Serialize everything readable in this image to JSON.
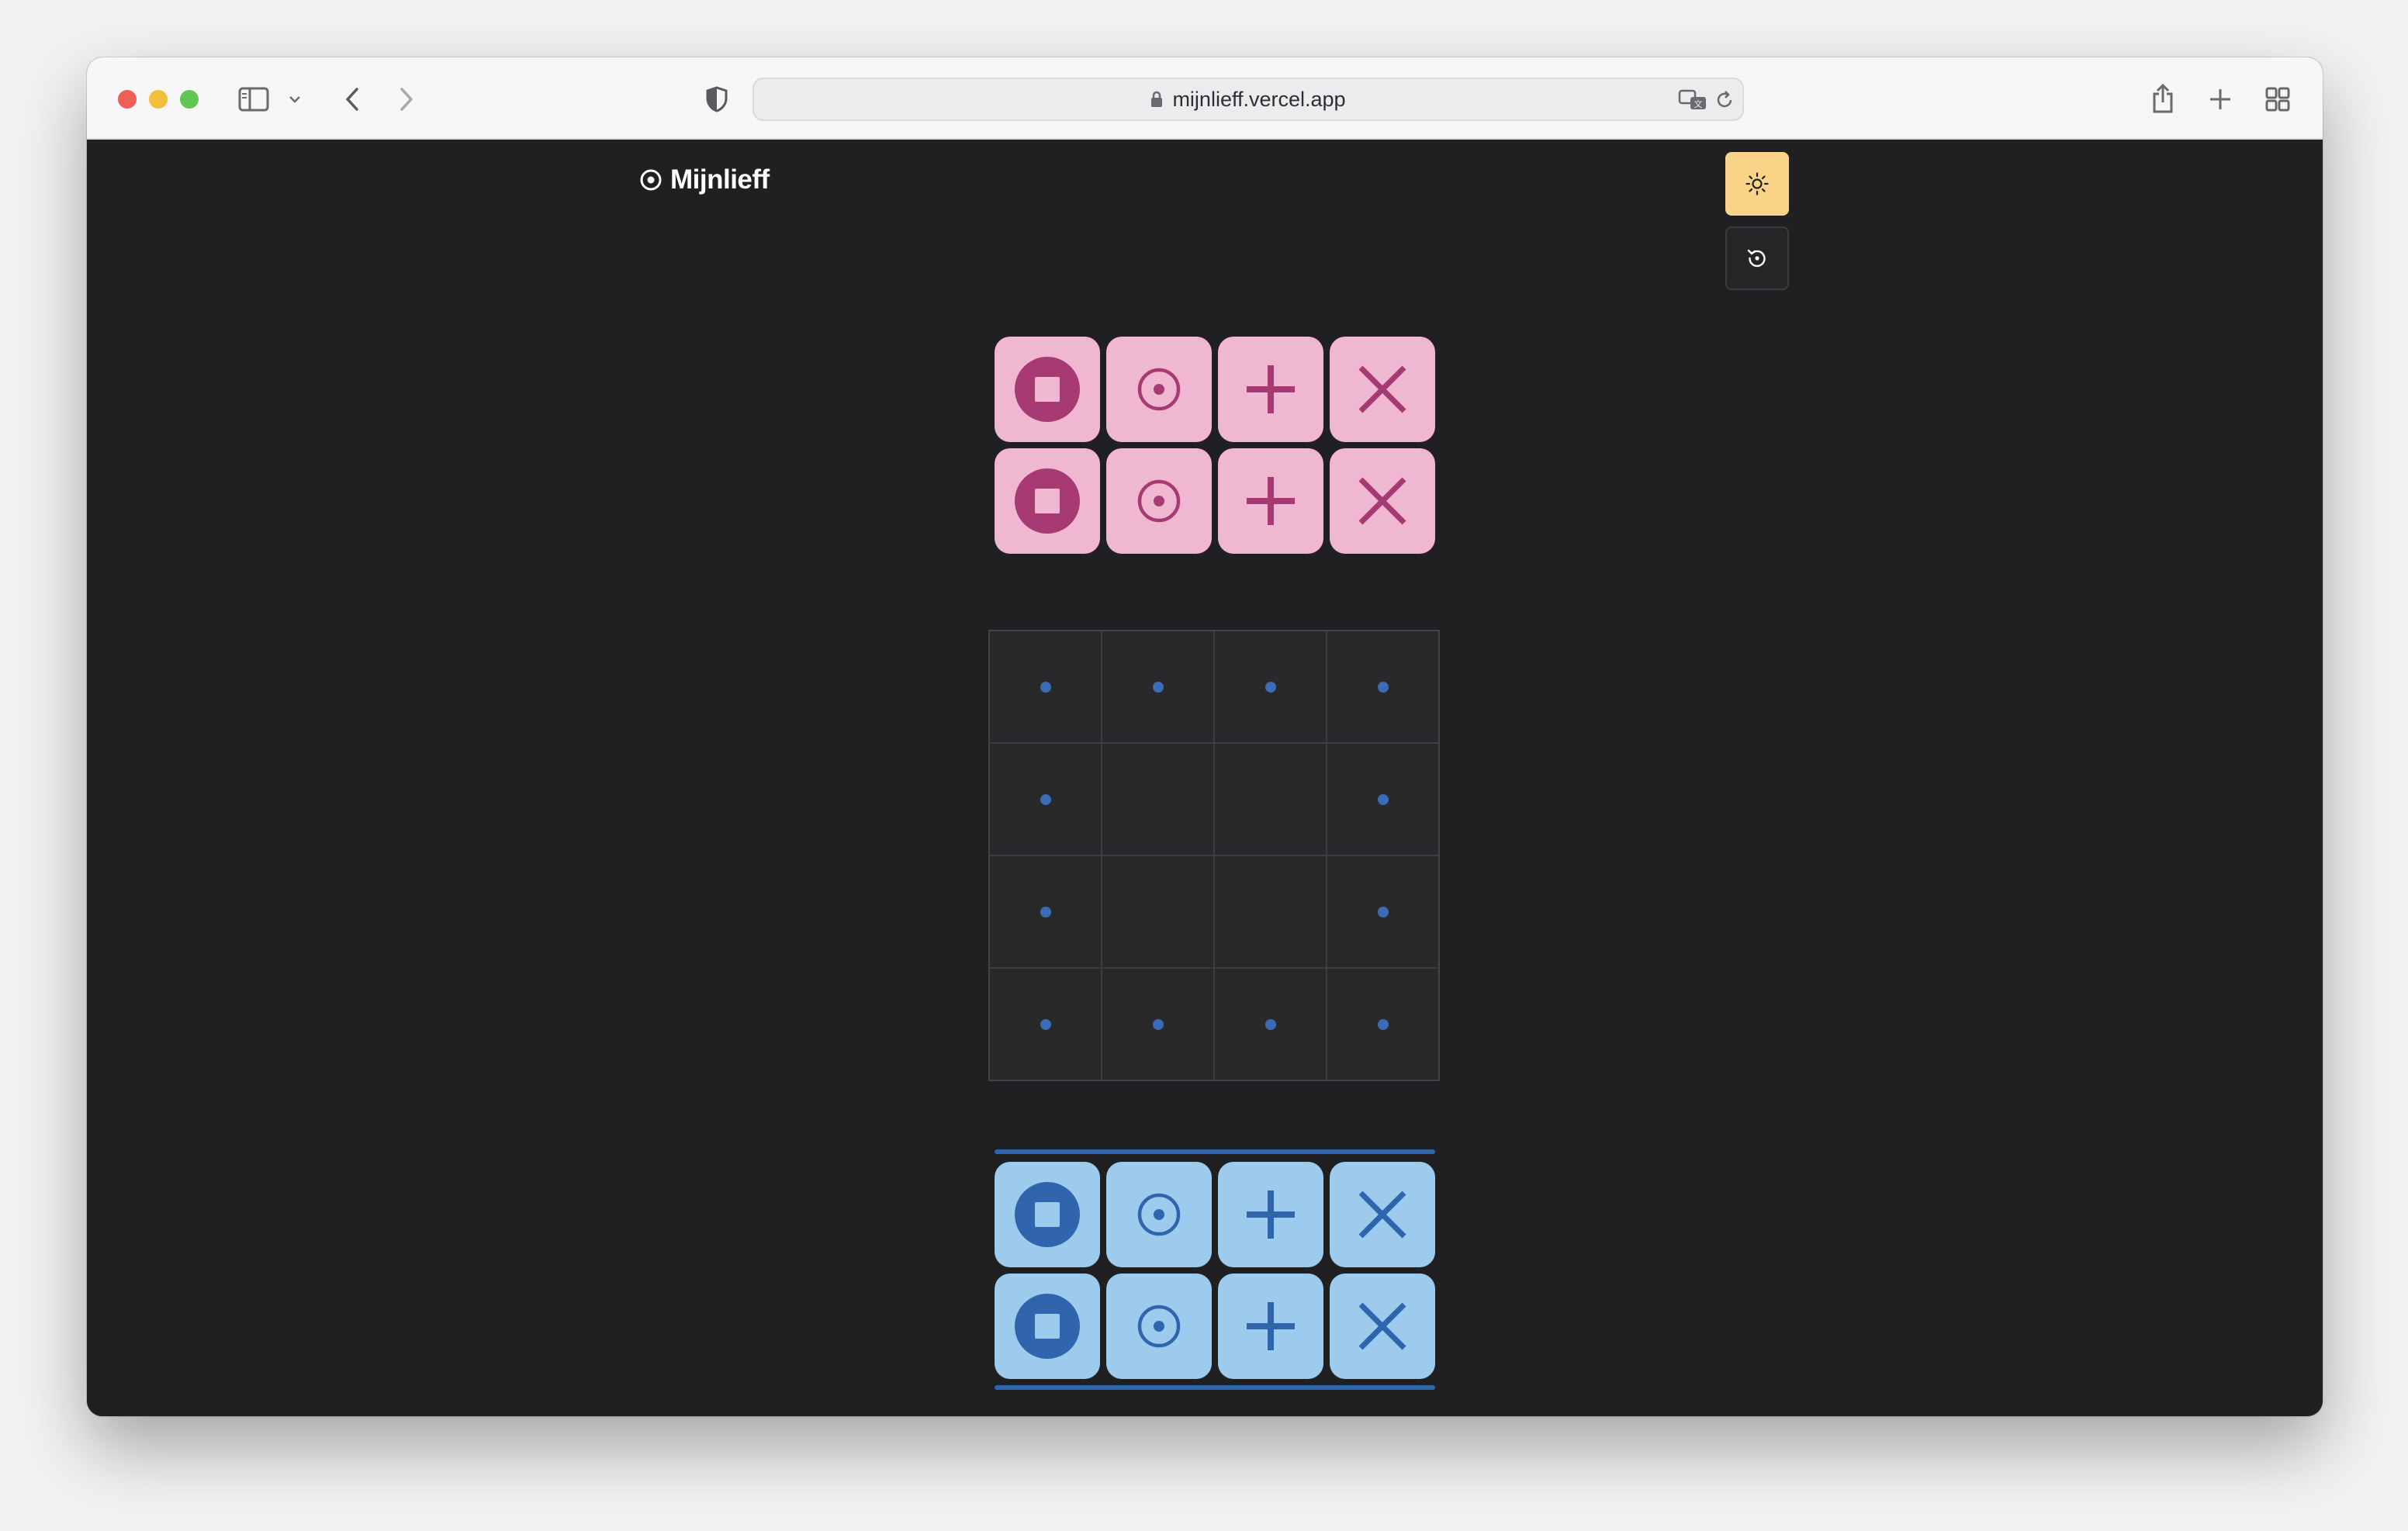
{
  "browser": {
    "url": "mijnlieff.vercel.app"
  },
  "app": {
    "logo_text": "Mijnlieff",
    "theme_toggle_icon": "sun-icon",
    "reset_icon": "rotate-icon"
  },
  "players": {
    "top": {
      "color": "#f0b8d0",
      "icon_color": "#a83a73",
      "pieces": [
        "circle-square-icon",
        "target-icon",
        "plus-icon",
        "x-icon",
        "circle-square-icon",
        "target-icon",
        "plus-icon",
        "x-icon"
      ]
    },
    "bottom": {
      "color": "#9ccbee",
      "icon_color": "#2f65ad",
      "active": true,
      "pieces": [
        "circle-square-icon",
        "target-icon",
        "plus-icon",
        "x-icon",
        "circle-square-icon",
        "target-icon",
        "plus-icon",
        "x-icon"
      ]
    }
  },
  "board": {
    "rows": 4,
    "cols": 4,
    "highlight_color": "#3a6cb8",
    "highlighted": [
      [
        true,
        true,
        true,
        true
      ],
      [
        true,
        false,
        false,
        true
      ],
      [
        true,
        false,
        false,
        true
      ],
      [
        true,
        true,
        true,
        true
      ]
    ]
  }
}
